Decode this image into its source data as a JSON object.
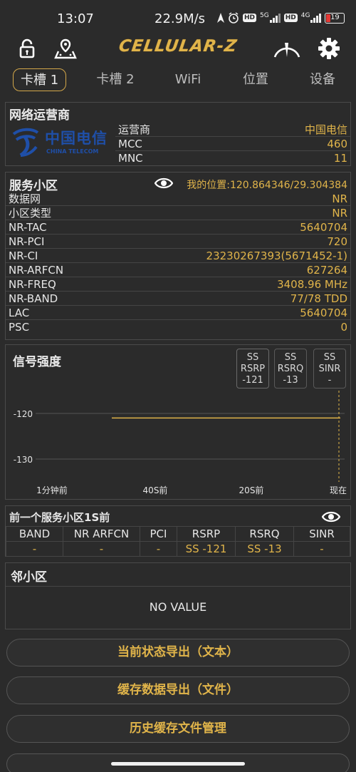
{
  "status_bar": {
    "time": "13:07",
    "net_speed": "22.9M/s",
    "icons": [
      "location-icon",
      "alarm-icon",
      "hd-icon",
      "5g-signal-icon",
      "4g-signal-icon",
      "battery-icon"
    ],
    "hd_badge": "HD",
    "net_5g": "5G",
    "net_4g": "4G",
    "battery": "19",
    "battery_color": "#e53935"
  },
  "toolbar": {
    "logo_text": "CELLULAR-Z",
    "logo_color": "#e0b44a",
    "icons": [
      "lock-icon",
      "location-map-icon",
      "speedometer-icon",
      "settings-gear-icon"
    ]
  },
  "tabs": [
    "卡槽 1",
    "卡槽 2",
    "WiFi",
    "位置",
    "设备"
  ],
  "operator": {
    "title": "网络运营商",
    "logo_cn": "中国电信",
    "logo_en": "CHINA TELECOM",
    "rows": [
      {
        "k": "运营商",
        "v": "中国电信"
      },
      {
        "k": "MCC",
        "v": "460"
      },
      {
        "k": "MNC",
        "v": "11"
      }
    ]
  },
  "serving": {
    "title": "服务小区",
    "location": "我的位置:120.864346/29.304384",
    "rows": [
      {
        "k": "数据网",
        "v": "NR"
      },
      {
        "k": "小区类型",
        "v": "NR"
      },
      {
        "k": "NR-TAC",
        "v": "5640704"
      },
      {
        "k": "NR-PCI",
        "v": "720"
      },
      {
        "k": "NR-CI",
        "v": "23230267393(5671452-1)"
      },
      {
        "k": "NR-ARFCN",
        "v": "627264"
      },
      {
        "k": "NR-FREQ",
        "v": "3408.96 MHz"
      },
      {
        "k": "NR-BAND",
        "v": "77/78 TDD"
      },
      {
        "k": "LAC",
        "v": "5640704"
      },
      {
        "k": "PSC",
        "v": "0"
      }
    ]
  },
  "signal": {
    "title": "信号强度",
    "pills": [
      {
        "line1": "SS",
        "line2": "RSRP",
        "line3": "-121"
      },
      {
        "line1": "SS",
        "line2": "RSRQ",
        "line3": "-13"
      },
      {
        "line1": "SS",
        "line2": "SINR",
        "line3": "-"
      }
    ],
    "y_ticks": [
      "-120",
      "-130"
    ],
    "x_ticks": [
      "1分钟前",
      "40S前",
      "20S前",
      "现在"
    ],
    "line_color": "#e0b44a"
  },
  "chart_data": {
    "type": "line",
    "title": "信号强度",
    "xlabel": "",
    "ylabel": "",
    "x_tick_labels": [
      "1分钟前",
      "40S前",
      "20S前",
      "现在"
    ],
    "y_tick_labels": [
      "-120",
      "-130"
    ],
    "series": [
      {
        "name": "SS RSRP",
        "x_seconds_ago": [
          45,
          0
        ],
        "values": [
          -121,
          -121
        ]
      }
    ]
  },
  "previous": {
    "title": "前一个服务小区1S前",
    "headers": [
      "BAND",
      "NR ARFCN",
      "PCI",
      "RSRP",
      "RSRQ",
      "SINR"
    ],
    "values": [
      "-",
      "-",
      "-",
      "SS -121",
      "SS -13",
      "-"
    ]
  },
  "neighbors": {
    "title": "邻小区",
    "empty_text": "NO VALUE"
  },
  "buttons": {
    "export_text": "当前状态导出（文本）",
    "export_file": "缓存数据导出（文件）",
    "history": "历史缓存文件管理"
  }
}
